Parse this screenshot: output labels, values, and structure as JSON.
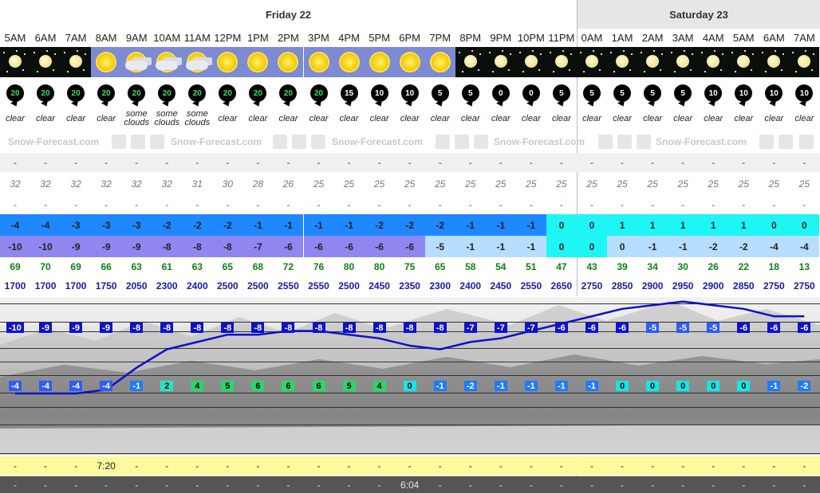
{
  "days": [
    {
      "label": "Friday 22"
    },
    {
      "label": "Saturday 23"
    }
  ],
  "hours": [
    "5AM",
    "6AM",
    "7AM",
    "8AM",
    "9AM",
    "10AM",
    "11AM",
    "12PM",
    "1PM",
    "2PM",
    "3PM",
    "4PM",
    "5PM",
    "6PM",
    "7PM",
    "8PM",
    "9PM",
    "10PM",
    "11PM",
    "0AM",
    "1AM",
    "2AM",
    "3AM",
    "4AM",
    "5AM",
    "6AM",
    "7AM"
  ],
  "icons": [
    "moon",
    "moon",
    "moon",
    "sun",
    "sun-cloud",
    "sun-cloud",
    "sun-cloud",
    "sun",
    "sun",
    "sun",
    "sun",
    "sun",
    "sun",
    "sun",
    "sun",
    "moon",
    "moon",
    "moon",
    "moon",
    "moon",
    "moon",
    "moon",
    "moon",
    "moon",
    "moon",
    "moon",
    "moon"
  ],
  "wind": [
    "20",
    "20",
    "20",
    "20",
    "20",
    "20",
    "20",
    "20",
    "20",
    "20",
    "20",
    "15",
    "10",
    "10",
    "5",
    "5",
    "0",
    "0",
    "5",
    "5",
    "5",
    "5",
    "5",
    "10",
    "10",
    "10",
    "10"
  ],
  "wind_green": [
    true,
    true,
    true,
    true,
    true,
    true,
    true,
    true,
    true,
    true,
    true,
    false,
    false,
    false,
    false,
    false,
    false,
    false,
    false,
    false,
    false,
    false,
    false,
    false,
    false,
    false,
    false
  ],
  "summary": [
    "clear",
    "clear",
    "clear",
    "clear",
    "some clouds",
    "some clouds",
    "some clouds",
    "clear",
    "clear",
    "clear",
    "clear",
    "clear",
    "clear",
    "clear",
    "clear",
    "clear",
    "clear",
    "clear",
    "clear",
    "clear",
    "clear",
    "clear",
    "clear",
    "clear",
    "clear",
    "clear",
    "clear"
  ],
  "brand": "Snow-Forecast.com",
  "dash": "-",
  "row_t1": [
    "32",
    "32",
    "32",
    "32",
    "32",
    "32",
    "31",
    "30",
    "28",
    "26",
    "25",
    "25",
    "25",
    "25",
    "25",
    "25",
    "25",
    "25",
    "25",
    "25",
    "25",
    "25",
    "25",
    "25",
    "25",
    "25",
    "25"
  ],
  "tmax": [
    "-4",
    "-4",
    "-3",
    "-3",
    "-3",
    "-2",
    "-2",
    "-2",
    "-1",
    "-1",
    "-1",
    "-1",
    "-2",
    "-2",
    "-2",
    "-1",
    "-1",
    "-1",
    "0",
    "0",
    "1",
    "1",
    "1",
    "1",
    "1",
    "0",
    "0"
  ],
  "tmin": [
    "-10",
    "-10",
    "-9",
    "-9",
    "-9",
    "-8",
    "-8",
    "-8",
    "-7",
    "-6",
    "-6",
    "-6",
    "-6",
    "-6",
    "-5",
    "-1",
    "-1",
    "-1",
    "0",
    "0",
    "0",
    "-1",
    "-1",
    "-2",
    "-2",
    "-4",
    "-4"
  ],
  "humidity": [
    "69",
    "70",
    "69",
    "66",
    "63",
    "61",
    "63",
    "65",
    "68",
    "72",
    "76",
    "80",
    "80",
    "75",
    "65",
    "58",
    "54",
    "51",
    "47",
    "43",
    "39",
    "34",
    "30",
    "26",
    "22",
    "18",
    "13"
  ],
  "freezing_level": [
    "1700",
    "1700",
    "1700",
    "1750",
    "2050",
    "2300",
    "2400",
    "2500",
    "2500",
    "2550",
    "2550",
    "2500",
    "2450",
    "2350",
    "2300",
    "2400",
    "2450",
    "2550",
    "2650",
    "2750",
    "2850",
    "2900",
    "2950",
    "2900",
    "2850",
    "2750",
    "2750"
  ],
  "top_temps": [
    "-10",
    "-9",
    "-9",
    "-9",
    "-8",
    "-8",
    "-8",
    "-8",
    "-8",
    "-8",
    "-8",
    "-8",
    "-8",
    "-8",
    "-8",
    "-7",
    "-7",
    "-7",
    "-6",
    "-6",
    "-6",
    "-5",
    "-5",
    "-5",
    "-6",
    "-6",
    "-6"
  ],
  "base_temps": [
    "-4",
    "-4",
    "-4",
    "-4",
    "-1",
    "2",
    "4",
    "5",
    "6",
    "6",
    "6",
    "5",
    "4",
    "0",
    "-1",
    "-2",
    "-1",
    "-1",
    "-1",
    "-1",
    "0",
    "0",
    "0",
    "0",
    "0",
    "-1",
    "-2"
  ],
  "sunrise": [
    "-",
    "-",
    "-",
    "7:20",
    "-",
    "-",
    "-",
    "-",
    "-",
    "-",
    "-",
    "-",
    "-",
    "-",
    "-",
    "-",
    "-",
    "-",
    "-",
    "-",
    "-",
    "-",
    "-",
    "-",
    "-",
    "-",
    "-"
  ],
  "sunset": [
    "-",
    "-",
    "-",
    "-",
    "-",
    "-",
    "-",
    "-",
    "-",
    "-",
    "-",
    "-",
    "-",
    "6:04",
    "-",
    "-",
    "-",
    "-",
    "-",
    "-",
    "-",
    "-",
    "-",
    "-",
    "-",
    "-",
    "-"
  ],
  "colors": {
    "tmax_blue": "#1e88ff",
    "tmax_cyan": "#1ff5f5",
    "tmin_violet": "#8f87f0",
    "tmin_light": "#b7ddff",
    "tmin_cyan": "#1ff5f5",
    "freezing_line": "#1010c8",
    "sunrise_bg": "#fafa9e",
    "sunset_bg": "#555555"
  }
}
